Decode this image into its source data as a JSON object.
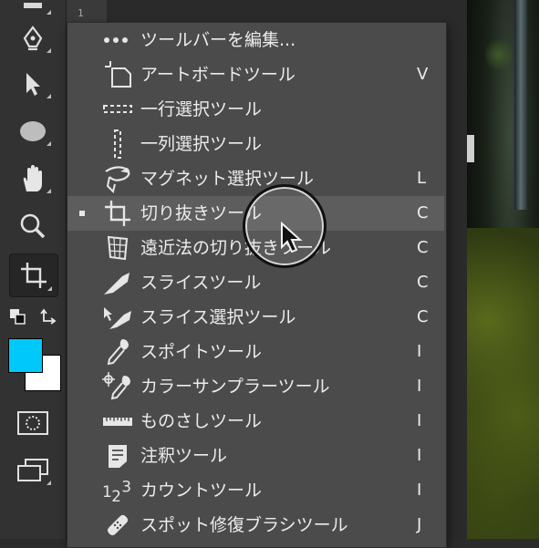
{
  "ruler": {
    "mark": "1"
  },
  "menu": {
    "items": [
      {
        "label": "ツールバーを編集...",
        "shortcut": "",
        "icon": "dots-icon",
        "selected": false
      },
      {
        "label": "アートボードツール",
        "shortcut": "V",
        "icon": "artboard-icon",
        "selected": false
      },
      {
        "label": "一行選択ツール",
        "shortcut": "",
        "icon": "single-row-marquee-icon",
        "selected": false
      },
      {
        "label": "一列選択ツール",
        "shortcut": "",
        "icon": "single-column-marquee-icon",
        "selected": false
      },
      {
        "label": "マグネット選択ツール",
        "shortcut": "L",
        "icon": "magnetic-lasso-icon",
        "selected": false
      },
      {
        "label": "切り抜きツール",
        "shortcut": "C",
        "icon": "crop-icon",
        "selected": true
      },
      {
        "label": "遠近法の切り抜きツール",
        "shortcut": "C",
        "icon": "perspective-crop-icon",
        "selected": false
      },
      {
        "label": "スライスツール",
        "shortcut": "C",
        "icon": "slice-icon",
        "selected": false
      },
      {
        "label": "スライス選択ツール",
        "shortcut": "C",
        "icon": "slice-select-icon",
        "selected": false
      },
      {
        "label": "スポイトツール",
        "shortcut": "I",
        "icon": "eyedropper-icon",
        "selected": false
      },
      {
        "label": "カラーサンプラーツール",
        "shortcut": "I",
        "icon": "color-sampler-icon",
        "selected": false
      },
      {
        "label": "ものさしツール",
        "shortcut": "I",
        "icon": "ruler-icon",
        "selected": false
      },
      {
        "label": "注釈ツール",
        "shortcut": "I",
        "icon": "note-icon",
        "selected": false
      },
      {
        "label": "カウントツール",
        "shortcut": "I",
        "icon": "count-icon",
        "selected": false
      },
      {
        "label": "スポット修復ブラシツール",
        "shortcut": "J",
        "icon": "spot-healing-icon",
        "selected": false
      }
    ]
  },
  "colors": {
    "foreground": "#00c8f8",
    "background": "#ffffff",
    "menu_bg": "#4b4b4b",
    "menu_highlight": "#5d5d5d"
  }
}
